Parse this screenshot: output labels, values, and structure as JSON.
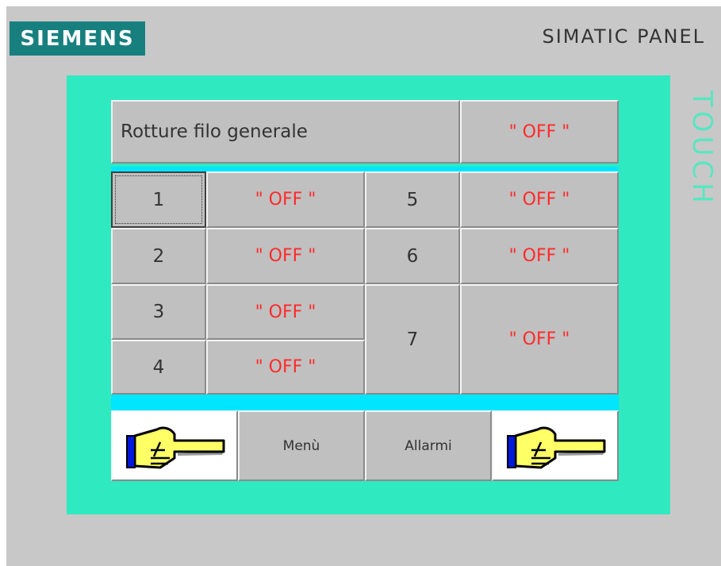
{
  "header": {
    "brand": "SIEMENS",
    "model": "SIMATIC PANEL",
    "side_label": "TOUCH"
  },
  "screen": {
    "title": "Rotture filo generale",
    "general_status": "\" OFF \"",
    "rows": [
      {
        "num": "1",
        "status": "\" OFF \""
      },
      {
        "num": "2",
        "status": "\" OFF \""
      },
      {
        "num": "3",
        "status": "\" OFF \""
      },
      {
        "num": "4",
        "status": "\" OFF \""
      },
      {
        "num": "5",
        "status": "\" OFF \""
      },
      {
        "num": "6",
        "status": "\" OFF \""
      },
      {
        "num": "7",
        "status": "\" OFF \""
      }
    ],
    "nav": {
      "back_icon": "pointing-hand-left-icon",
      "menu_label": "Menù",
      "alarms_label": "Allarmi",
      "forward_icon": "pointing-hand-right-icon"
    }
  },
  "colors": {
    "brand_bg": "#17807f",
    "screen_bg": "#2fe9c1",
    "status_text": "#ff2a2a",
    "touch_text": "#58e6c0"
  }
}
